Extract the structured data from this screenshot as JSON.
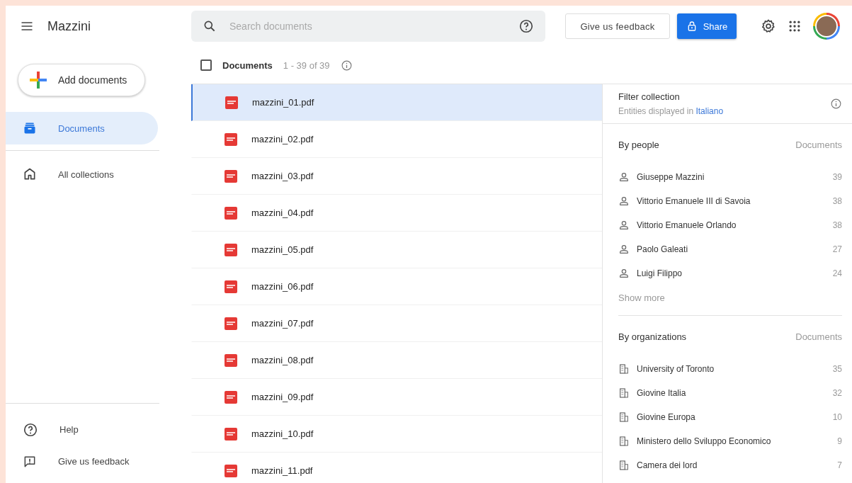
{
  "app": {
    "title": "Mazzini"
  },
  "search": {
    "placeholder": "Search documents"
  },
  "header_buttons": {
    "feedback": "Give us feedback",
    "share": "Share"
  },
  "sidebar": {
    "add_button": "Add documents",
    "items": [
      {
        "label": "Documents",
        "kind": "documents",
        "selected": true
      },
      {
        "label": "All collections",
        "kind": "collections",
        "selected": false
      }
    ],
    "footer": [
      {
        "label": "Help",
        "kind": "help"
      },
      {
        "label": "Give us feedback",
        "kind": "feedback"
      }
    ]
  },
  "list": {
    "title": "Documents",
    "count": "1 - 39 of 39",
    "checked": false,
    "rows": [
      {
        "name": "mazzini_01.pdf",
        "selected": true
      },
      {
        "name": "mazzini_02.pdf",
        "selected": false
      },
      {
        "name": "mazzini_03.pdf",
        "selected": false
      },
      {
        "name": "mazzini_04.pdf",
        "selected": false
      },
      {
        "name": "mazzini_05.pdf",
        "selected": false
      },
      {
        "name": "mazzini_06.pdf",
        "selected": false
      },
      {
        "name": "mazzini_07.pdf",
        "selected": false
      },
      {
        "name": "mazzini_08.pdf",
        "selected": false
      },
      {
        "name": "mazzini_09.pdf",
        "selected": false
      },
      {
        "name": "mazzini_10.pdf",
        "selected": false
      },
      {
        "name": "mazzini_11.pdf",
        "selected": false
      }
    ]
  },
  "filter": {
    "title": "Filter collection",
    "subtitle": "Entities displayed in",
    "language": "Italiano",
    "sections": [
      {
        "title": "By people",
        "column": "Documents",
        "kind": "person",
        "more": "Show more",
        "items": [
          {
            "name": "Giuseppe Mazzini",
            "count": "39"
          },
          {
            "name": "Vittorio Emanuele III di Savoia",
            "count": "38"
          },
          {
            "name": "Vittorio Emanuele Orlando",
            "count": "38"
          },
          {
            "name": "Paolo Galeati",
            "count": "27"
          },
          {
            "name": "Luigi Filippo",
            "count": "24"
          }
        ]
      },
      {
        "title": "By organizations",
        "column": "Documents",
        "kind": "organization",
        "items": [
          {
            "name": "University of Toronto",
            "count": "35"
          },
          {
            "name": "Giovine Italia",
            "count": "32"
          },
          {
            "name": "Giovine Europa",
            "count": "10"
          },
          {
            "name": "Ministero dello Sviluppo Economico",
            "count": "9"
          },
          {
            "name": "Camera dei lord",
            "count": "7"
          }
        ]
      }
    ]
  }
}
